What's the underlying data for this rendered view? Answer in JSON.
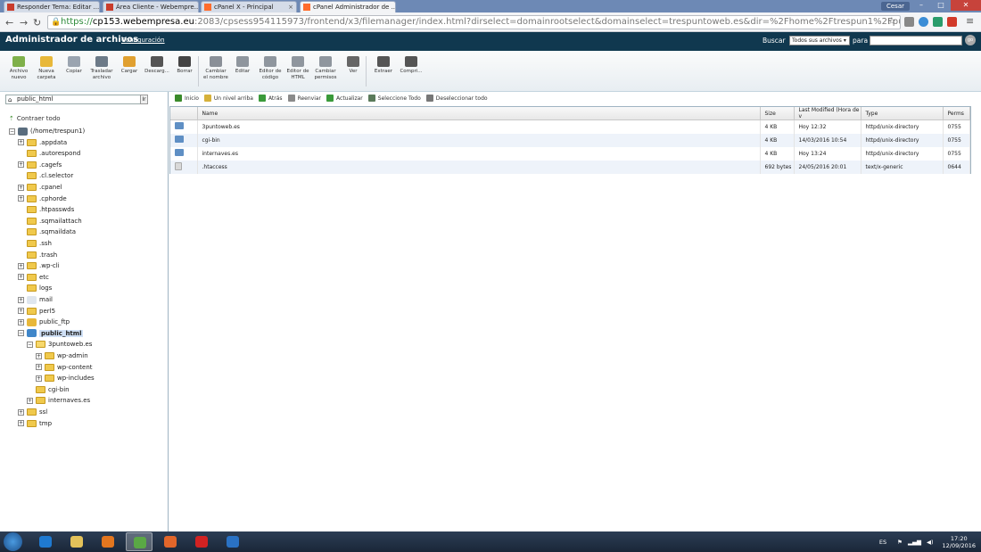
{
  "browser": {
    "tabs": [
      {
        "label": "Responder Tema: Editar ...",
        "active": false
      },
      {
        "label": "Área Cliente - Webempre...",
        "active": false
      },
      {
        "label": "cPanel X - Principal",
        "active": false
      },
      {
        "label": "cPanel Administrador de ...",
        "active": true
      }
    ],
    "user": "Cesar",
    "url_scheme": "https://",
    "url_host": "cp153.webempresa.eu",
    "url_path": ":2083/cpsess954115973/frontend/x3/filemanager/index.html?dirselect=domainrootselect&domainselect=trespuntoweb.es&dir=%2Fhome%2Ftrespun1%2Fpublic_html&showhidden=1"
  },
  "header": {
    "title": "Administrador de archivos",
    "config_link": "Configuración",
    "search_label": "Buscar",
    "search_scope": "Todos sus archivos",
    "para_label": "para",
    "search_value": "",
    "go_label": "go"
  },
  "toolbar": [
    {
      "id": "new-file",
      "label": "Archivo nuevo",
      "icon": "new-file-icon",
      "color": "#7fb04a"
    },
    {
      "id": "new-folder",
      "label": "Nueva carpeta",
      "icon": "new-folder-icon",
      "color": "#e8b83a"
    },
    {
      "id": "copy",
      "label": "Copiar",
      "icon": "copy-icon",
      "color": "#9aa4b0"
    },
    {
      "id": "move",
      "label": "Trasladar archivo",
      "icon": "move-icon",
      "color": "#6c7a88"
    },
    {
      "id": "upload",
      "label": "Cargar",
      "icon": "upload-icon",
      "color": "#e0a030"
    },
    {
      "id": "download",
      "label": "Descarg...",
      "icon": "download-icon",
      "color": "#555555"
    },
    {
      "id": "delete",
      "label": "Borrar",
      "icon": "delete-icon",
      "color": "#444444"
    },
    {
      "id": "rename",
      "label": "Cambiar el nombre",
      "icon": "rename-icon",
      "color": "#8a9098"
    },
    {
      "id": "edit",
      "label": "Editar",
      "icon": "edit-icon",
      "color": "#8f969e"
    },
    {
      "id": "code-editor",
      "label": "Editor de código",
      "icon": "code-editor-icon",
      "color": "#8f969e"
    },
    {
      "id": "html-editor",
      "label": "Editor de HTML",
      "icon": "html-editor-icon",
      "color": "#8f969e"
    },
    {
      "id": "permissions",
      "label": "Cambiar permisos",
      "icon": "permissions-icon",
      "color": "#8f969e"
    },
    {
      "id": "view",
      "label": "Ver",
      "icon": "magnifier-icon",
      "color": "#666666"
    },
    {
      "id": "extract",
      "label": "Extraer",
      "icon": "extract-icon",
      "color": "#555555"
    },
    {
      "id": "compress",
      "label": "Compri...",
      "icon": "compress-icon",
      "color": "#555555"
    }
  ],
  "left": {
    "path_value": "public_html",
    "path_go": "Ir",
    "collapse_label": "Contraer todo",
    "tree": [
      {
        "label": "(/home/trespun1)",
        "depth": 0,
        "pm": "−",
        "kind": "home"
      },
      {
        "label": ".appdata",
        "depth": 1,
        "pm": "+",
        "kind": "folder"
      },
      {
        "label": ".autorespond",
        "depth": 1,
        "pm": "",
        "kind": "folder"
      },
      {
        "label": ".cagefs",
        "depth": 1,
        "pm": "+",
        "kind": "folder"
      },
      {
        "label": ".cl.selector",
        "depth": 1,
        "pm": "",
        "kind": "folder"
      },
      {
        "label": ".cpanel",
        "depth": 1,
        "pm": "+",
        "kind": "folder"
      },
      {
        "label": ".cphorde",
        "depth": 1,
        "pm": "+",
        "kind": "folder"
      },
      {
        "label": ".htpasswds",
        "depth": 1,
        "pm": "",
        "kind": "folder"
      },
      {
        "label": ".sqmailattach",
        "depth": 1,
        "pm": "",
        "kind": "folder"
      },
      {
        "label": ".sqmaildata",
        "depth": 1,
        "pm": "",
        "kind": "folder"
      },
      {
        "label": ".ssh",
        "depth": 1,
        "pm": "",
        "kind": "folder"
      },
      {
        "label": ".trash",
        "depth": 1,
        "pm": "",
        "kind": "folder"
      },
      {
        "label": ".wp-cli",
        "depth": 1,
        "pm": "+",
        "kind": "folder"
      },
      {
        "label": "etc",
        "depth": 1,
        "pm": "+",
        "kind": "folder"
      },
      {
        "label": "logs",
        "depth": 1,
        "pm": "",
        "kind": "folder"
      },
      {
        "label": "mail",
        "depth": 1,
        "pm": "+",
        "kind": "mail"
      },
      {
        "label": "perl5",
        "depth": 1,
        "pm": "+",
        "kind": "folder"
      },
      {
        "label": "public_ftp",
        "depth": 1,
        "pm": "+",
        "kind": "ftp"
      },
      {
        "label": "public_html",
        "depth": 1,
        "pm": "−",
        "kind": "web",
        "selected": true
      },
      {
        "label": "3puntoweb.es",
        "depth": 2,
        "pm": "−",
        "kind": "open"
      },
      {
        "label": "wp-admin",
        "depth": 3,
        "pm": "+",
        "kind": "folder"
      },
      {
        "label": "wp-content",
        "depth": 3,
        "pm": "+",
        "kind": "folder"
      },
      {
        "label": "wp-includes",
        "depth": 3,
        "pm": "+",
        "kind": "folder"
      },
      {
        "label": "cgi-bin",
        "depth": 2,
        "pm": "",
        "kind": "folder"
      },
      {
        "label": "internaves.es",
        "depth": 2,
        "pm": "+",
        "kind": "folder"
      },
      {
        "label": "ssl",
        "depth": 1,
        "pm": "+",
        "kind": "folder"
      },
      {
        "label": "tmp",
        "depth": 1,
        "pm": "+",
        "kind": "folder"
      }
    ]
  },
  "subtoolbar": [
    {
      "id": "home",
      "label": "Inicio",
      "icon": "home-icon",
      "color": "#3a8a2a"
    },
    {
      "id": "up",
      "label": "Un nivel arriba",
      "icon": "up-level-icon",
      "color": "#d6b13a"
    },
    {
      "id": "back",
      "label": "Atrás",
      "icon": "back-arrow-icon",
      "color": "#3a9a3a"
    },
    {
      "id": "forward",
      "label": "Reenviar",
      "icon": "forward-arrow-icon",
      "color": "#8a8a8a"
    },
    {
      "id": "reload",
      "label": "Actualizar",
      "icon": "reload-icon",
      "color": "#3a9a3a"
    },
    {
      "id": "select-all",
      "label": "Seleccione Todo",
      "icon": "checkbox-checked-icon",
      "color": "#5a7a5a"
    },
    {
      "id": "deselect-all",
      "label": "Deseleccionar todo",
      "icon": "checkbox-empty-icon",
      "color": "#777777"
    }
  ],
  "table": {
    "columns": [
      "Name",
      "Size",
      "Last Modified (Hora de v",
      "Type",
      "Perms"
    ],
    "rows": [
      {
        "icon": "folder-icon",
        "kind": "dir",
        "name": "3puntoweb.es",
        "size": "4 KB",
        "modified": "Hoy 12:32",
        "type": "httpd/unix-directory",
        "perms": "0755"
      },
      {
        "icon": "folder-icon",
        "kind": "dir",
        "name": "cgi-bin",
        "size": "4 KB",
        "modified": "14/03/2016 10:54",
        "type": "httpd/unix-directory",
        "perms": "0755"
      },
      {
        "icon": "folder-icon",
        "kind": "dir",
        "name": "internaves.es",
        "size": "4 KB",
        "modified": "Hoy 13:24",
        "type": "httpd/unix-directory",
        "perms": "0755"
      },
      {
        "icon": "file-icon",
        "kind": "file",
        "name": ".htaccess",
        "size": "692 bytes",
        "modified": "24/05/2016 20:01",
        "type": "text/x-generic",
        "perms": "0644"
      }
    ]
  },
  "taskbar": {
    "apps": [
      {
        "name": "internet-explorer-icon",
        "color": "#1f7ad1",
        "active": false
      },
      {
        "name": "file-explorer-icon",
        "color": "#e3c25a",
        "active": false
      },
      {
        "name": "media-player-icon",
        "color": "#e3761f",
        "active": false
      },
      {
        "name": "chrome-icon",
        "color": "#5aa845",
        "active": true
      },
      {
        "name": "firefox-icon",
        "color": "#e2662a",
        "active": false
      },
      {
        "name": "opera-icon",
        "color": "#d22222",
        "active": false
      },
      {
        "name": "outlook-icon",
        "color": "#2a72c4",
        "active": false
      }
    ],
    "lang": "ES",
    "time": "17:20",
    "date": "12/09/2016"
  }
}
